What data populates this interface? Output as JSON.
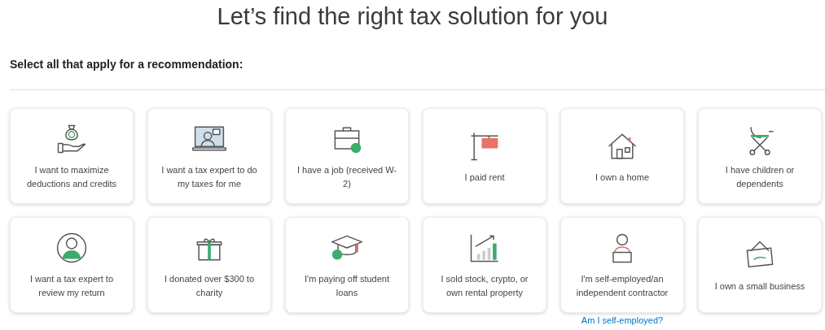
{
  "title": "Let’s find the right tax solution for you",
  "subtitle": "Select all that apply for a recommendation:",
  "options": [
    {
      "label": "I want to maximize deductions and credits",
      "selected": false
    },
    {
      "label": "I want a tax expert to do my taxes for me",
      "selected": false
    },
    {
      "label": "I have a job (received W-2)",
      "selected": false
    },
    {
      "label": "I paid rent",
      "selected": false
    },
    {
      "label": "I own a home",
      "selected": false
    },
    {
      "label": "I have children or dependents",
      "selected": false
    },
    {
      "label": "I want a tax expert to review my return",
      "selected": false
    },
    {
      "label": "I donated over $300 to charity",
      "selected": false
    },
    {
      "label": "I'm paying off student loans",
      "selected": false
    },
    {
      "label": "I sold stock, crypto, or own rental property",
      "selected": false
    },
    {
      "label": "I'm self-employed/an independent contractor",
      "selected": false,
      "link": "Am I self-employed?"
    },
    {
      "label": "I own a small business",
      "selected": false
    }
  ]
}
